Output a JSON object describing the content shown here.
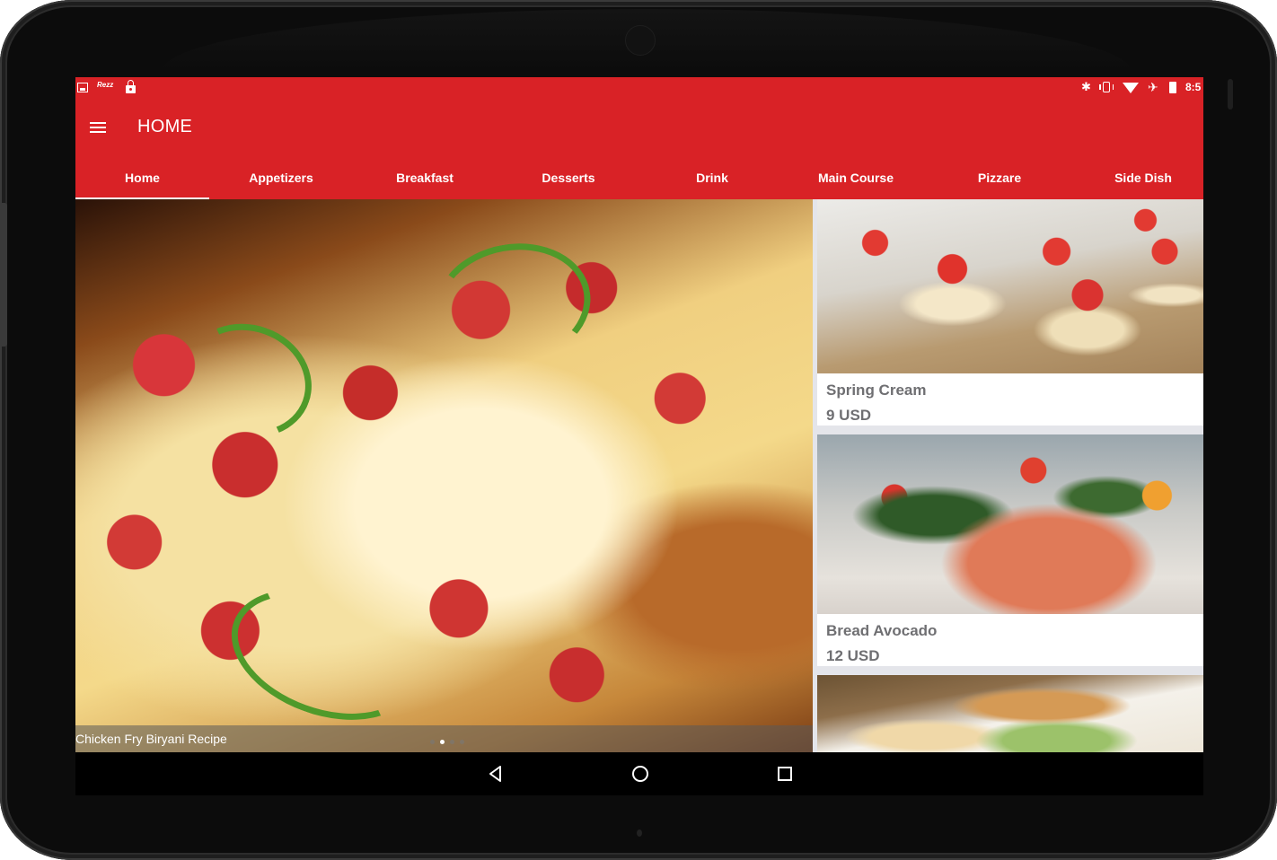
{
  "status_bar": {
    "left_icons": [
      "gallery-icon",
      "wifi-brand-icon",
      "lock-icon"
    ],
    "right_icons": [
      "bluetooth-icon",
      "vibrate-icon",
      "signal-icon",
      "airplane-mode-icon",
      "battery-icon"
    ],
    "time": "8:5",
    "bluetooth_glyph": "✱",
    "airplane_glyph": "✈",
    "wifi_brand_text": "Rezz"
  },
  "toolbar": {
    "title": "HOME",
    "menu_icon": "hamburger-menu-icon"
  },
  "tabs": [
    {
      "label": "Home",
      "active": true
    },
    {
      "label": "Appetizers",
      "active": false
    },
    {
      "label": "Breakfast",
      "active": false
    },
    {
      "label": "Desserts",
      "active": false
    },
    {
      "label": "Drink",
      "active": false
    },
    {
      "label": "Main Course",
      "active": false
    },
    {
      "label": "Pizzare",
      "active": false
    },
    {
      "label": "Side Dish",
      "active": false
    }
  ],
  "slider": {
    "caption": "Chicken Fry Biryani Recipe",
    "image": "pizza-photo",
    "dots_count": 4,
    "active_dot": 2
  },
  "cards": [
    {
      "title": "Spring Cream",
      "price": "9 USD",
      "image": "tartlets-photo"
    },
    {
      "title": "Bread Avocado",
      "price": "12 USD",
      "image": "salmon-salad-photo"
    },
    {
      "title": "",
      "price": "",
      "image": "sandwich-fries-photo"
    }
  ],
  "nav_bar": {
    "buttons": [
      "back-icon",
      "home-icon",
      "recent-apps-icon"
    ]
  },
  "colors": {
    "primary": "#d92226",
    "background": "#e4e5ea",
    "card_text": "#6f6f72"
  }
}
